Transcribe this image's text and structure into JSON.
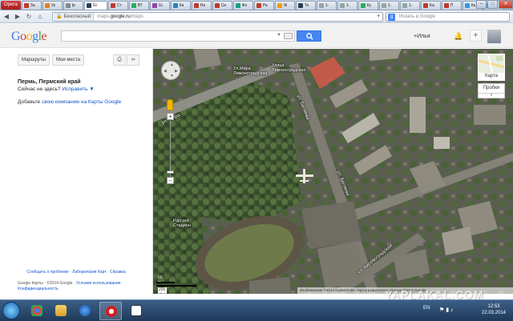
{
  "browser": {
    "menu_label": "Opera",
    "tabs": [
      {
        "label": "За",
        "color": "#c0392b"
      },
      {
        "label": "Ук",
        "color": "#e67e22"
      },
      {
        "label": "Ip",
        "color": "#7f8c8d"
      },
      {
        "label": "Gi",
        "color": "#2c3e50"
      },
      {
        "label": "Ст",
        "color": "#c0392b"
      },
      {
        "label": "ВТ",
        "color": "#27ae60"
      },
      {
        "label": "Gi",
        "color": "#8e44ad"
      },
      {
        "label": "Ка",
        "color": "#2980b9"
      },
      {
        "label": "На",
        "color": "#c0392b"
      },
      {
        "label": "Си",
        "color": "#c0392b"
      },
      {
        "label": "Фо",
        "color": "#16a085"
      },
      {
        "label": "Ра",
        "color": "#c0392b"
      },
      {
        "label": "Ж",
        "color": "#f39c12"
      },
      {
        "label": "Те",
        "color": "#2c3e50"
      },
      {
        "label": "1-",
        "color": "#95a5a6"
      },
      {
        "label": "1-",
        "color": "#95a5a6"
      },
      {
        "label": "Ку",
        "color": "#27ae60"
      },
      {
        "label": "1-",
        "color": "#95a5a6"
      },
      {
        "label": "1-",
        "color": "#95a5a6"
      },
      {
        "label": "Ka",
        "color": "#c0392b"
      },
      {
        "label": "П",
        "color": "#c0392b"
      },
      {
        "label": "Ка",
        "color": "#3498db"
      },
      {
        "label": "",
        "color": "#3498db"
      }
    ],
    "secure_label": "Безопасный",
    "url_prefix": "maps.",
    "url_domain": "google.ru",
    "url_suffix": "/maps",
    "search_placeholder": "Искать в Google"
  },
  "google_header": {
    "user_label": "+Илья",
    "plus_label": "+"
  },
  "left_panel": {
    "routes_button": "Маршруты",
    "my_places_button": "Мои места",
    "place_title": "Пермь, Пермский край",
    "not_here_text": "Сейчас не здесь?",
    "fix_link": "Исправить ▼",
    "add_text": "Добавьте",
    "add_link": "свою компанию на Карты Google",
    "footer_links": "Сообщить о проблеме · Лаборатория Карт · Справка",
    "copyright_brand": "Google Карты",
    "copyright_text": " · ©2014 Google · ",
    "terms_link": "Условия использования",
    "privacy_link": "Конфиденциальность"
  },
  "map": {
    "layer_label": "Карта",
    "traffic_label": "Пробки",
    "street_1": "ул. Мира",
    "street_2": "ул. Беляева",
    "street_3": "ул. Беляева",
    "street_4": "ул. Кировоградская",
    "poi_1": "Ул.Мира\nЛимоноградская",
    "poi_2": "Улица\nЛимоноградская",
    "poi_3": "Курсант\nСтадион",
    "scale_top": "50 м",
    "scale_bottom": "200 фут",
    "credit": "Изображения ©2014 DigitalGlobe, Картографические данные ©2014 Google"
  },
  "taskbar": {
    "lang": "EN",
    "time": "12:53",
    "date": "22.03.2014"
  },
  "watermark": "YAPLAKAL.COM"
}
